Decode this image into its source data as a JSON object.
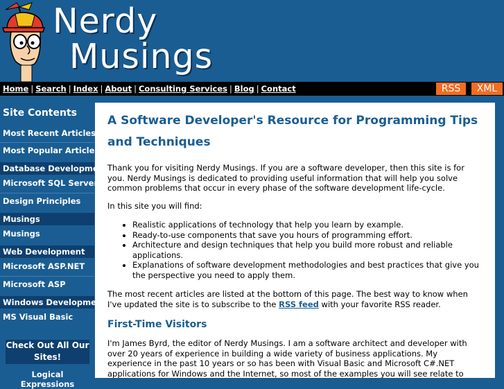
{
  "header": {
    "logo_line1": "Nerdy",
    "logo_line2": "Musings"
  },
  "nav": {
    "items": [
      "Home",
      "Search",
      "Index",
      "About",
      "Consulting Services",
      "Blog",
      "Contact"
    ],
    "separator": "|",
    "rss_label": "RSS",
    "xml_label": "XML"
  },
  "sidebar": {
    "title": "Site Contents",
    "most_recent": "Most Recent Articles",
    "most_popular": "Most Popular Articles",
    "sections": [
      {
        "heading": "Database Development",
        "items": [
          "Microsoft SQL Server",
          "Design Principles"
        ]
      },
      {
        "heading": "Musings",
        "items": [
          "Musings"
        ]
      },
      {
        "heading": "Web Development",
        "items": [
          "Microsoft ASP.NET",
          "Microsoft ASP"
        ]
      },
      {
        "heading": "Windows Development",
        "items": [
          "MS Visual Basic"
        ]
      }
    ],
    "checkout": "Check Out All Our Sites!",
    "logical": "Logical Expressions"
  },
  "content": {
    "title": "A Software Developer's Resource for Programming Tips and Techniques",
    "intro": "Thank you for visiting Nerdy Musings. If you are a software developer, then this site is for you. Nerdy Musings is dedicated to providing useful information that will help you solve common problems that occur in every phase of the software development life-cycle.",
    "find": "In this site you will find:",
    "features": [
      "Realistic applications of technology that help you learn by example.",
      "Ready-to-use components that save you hours of programming effort.",
      "Architecture and design techniques that help you build more robust and reliable applications.",
      "Explanations of software development methodologies and best practices that give you the perspective you need to apply them."
    ],
    "recent_before": "The most recent articles are listed at the bottom of this page. The best way to know when I've updated the site is to subscribe to the ",
    "recent_link": "RSS feed",
    "recent_after": " with your favorite RSS reader.",
    "first_time_heading": "First-Time Visitors",
    "bio": "I'm James Byrd, the editor of Nerdy Musings. I am a software architect and developer with over 20 years of experience in building a wide variety of business applications. My experience in the past 10 years or so has been with Visual Basic and Microsoft C#.NET applications for Windows and the Internet, so most of the examples you will see relate to those environments."
  }
}
